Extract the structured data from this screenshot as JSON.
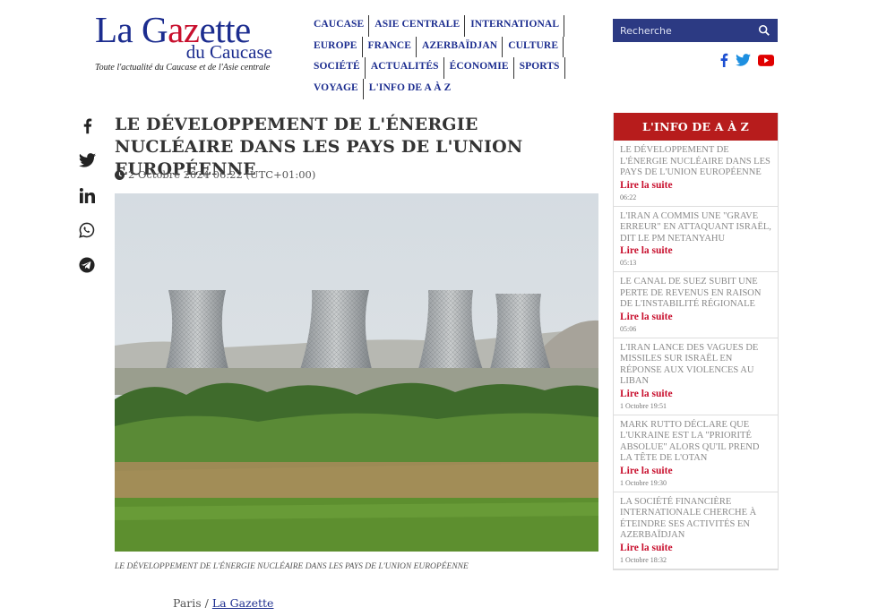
{
  "brand": {
    "name_part1": "La G",
    "name_accent": "az",
    "name_part2": "ette",
    "name_line2": "du Caucase",
    "tagline": "Toute l'actualité du Caucase et de l'Asie centrale"
  },
  "nav": [
    "CAUCASE",
    "ASIE CENTRALE",
    "INTERNATIONAL",
    "EUROPE",
    "FRANCE",
    "AZERBAÏDJAN",
    "CULTURE",
    "SOCIÉTÉ",
    "ACTUALITÉS",
    "ÉCONOMIE",
    "SPORTS",
    "VOYAGE",
    "L'INFO DE A À Z"
  ],
  "search": {
    "placeholder": "Recherche"
  },
  "colors": {
    "brand_blue": "#1c2d8f",
    "accent_red": "#c8102e",
    "search_bg": "#2c3a83",
    "sidebar_head": "#b71c1c"
  },
  "social_top": [
    "facebook-icon",
    "twitter-icon",
    "youtube-icon"
  ],
  "share": [
    "facebook-icon",
    "twitter-icon",
    "linkedin-icon",
    "whatsapp-icon",
    "telegram-icon"
  ],
  "article": {
    "title": "LE DÉVELOPPEMENT DE L'ÉNERGIE NUCLÉAIRE DANS LES PAYS DE L'UNION EUROPÉENNE",
    "date": "2 Octobre 2024 06:22 (UTC+01:00)",
    "caption": "LE DÉVELOPPEMENT DE L'ÉNERGIE NUCLÉAIRE DANS LES PAYS DE L'UNION EUROPÉENNE",
    "source_city": "Paris / ",
    "source_link": "La Gazette"
  },
  "sidebar": {
    "title": "L'INFO DE A À Z",
    "read_more": "Lire la suite",
    "items": [
      {
        "title": "LE DÉVELOPPEMENT DE L'ÉNERGIE NUCLÉAIRE DANS LES PAYS DE L'UNION EUROPÉENNE",
        "time": "06:22"
      },
      {
        "title": "L'IRAN A COMMIS UNE \"GRAVE ERREUR\" EN ATTAQUANT ISRAËL, DIT LE PM NETANYAHU",
        "time": "05:13"
      },
      {
        "title": "LE CANAL DE SUEZ SUBIT UNE PERTE DE REVENUS EN RAISON DE L'INSTABILITÉ RÉGIONALE",
        "time": "05:06"
      },
      {
        "title": "L'IRAN LANCE DES VAGUES DE MISSILES SUR ISRAËL EN RÉPONSE AUX VIOLENCES AU LIBAN",
        "time": "1 Octobre 19:51"
      },
      {
        "title": "MARK RUTTO DÉCLARE QUE L'UKRAINE EST LA \"PRIORITÉ ABSOLUE\" ALORS QU'IL PREND LA TÊTE DE L'OTAN",
        "time": "1 Octobre 19:30"
      },
      {
        "title": "LA SOCIÉTÉ FINANCIÈRE INTERNATIONALE CHERCHE À ÉTEINDRE SES ACTIVITÉS EN AZERBAÏDJAN",
        "time": "1 Octobre 18:32"
      }
    ]
  }
}
